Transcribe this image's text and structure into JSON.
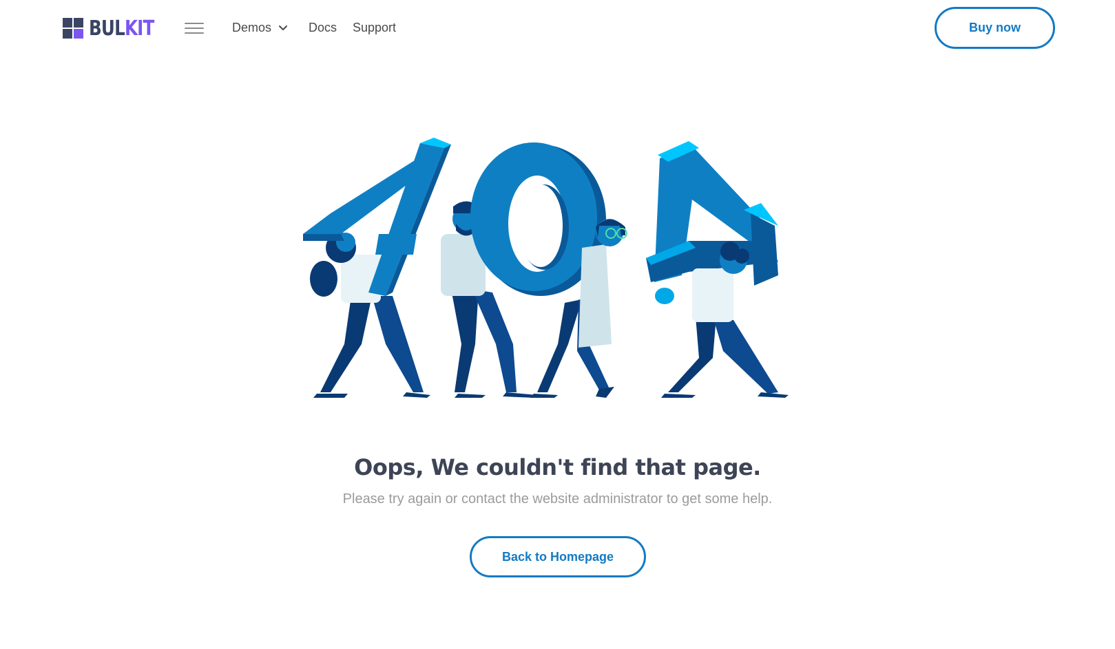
{
  "brand": {
    "logo_part1": "BUL",
    "logo_part2": "KIT"
  },
  "navbar": {
    "links": [
      {
        "label": "Demos",
        "has_dropdown": true
      },
      {
        "label": "Docs"
      },
      {
        "label": "Support"
      }
    ],
    "cta_label": "Buy now"
  },
  "error_page": {
    "illustration_text": "404",
    "headline": "Oops, We couldn't find that page.",
    "subtext": "Please try again or contact the website administrator to get some help.",
    "button_label": "Back to Homepage"
  },
  "colors": {
    "accent": "#137ac4",
    "brand_purple": "#7b55f2",
    "brand_dark": "#3a4563",
    "illustration_blue": "#0f7fc4",
    "illustration_light": "#00c6ff",
    "illustration_navy": "#0a3a73"
  },
  "icons": {
    "menu": "hamburger-icon",
    "dropdown": "chevron-down-icon",
    "logo": "grid-logo-icon"
  }
}
